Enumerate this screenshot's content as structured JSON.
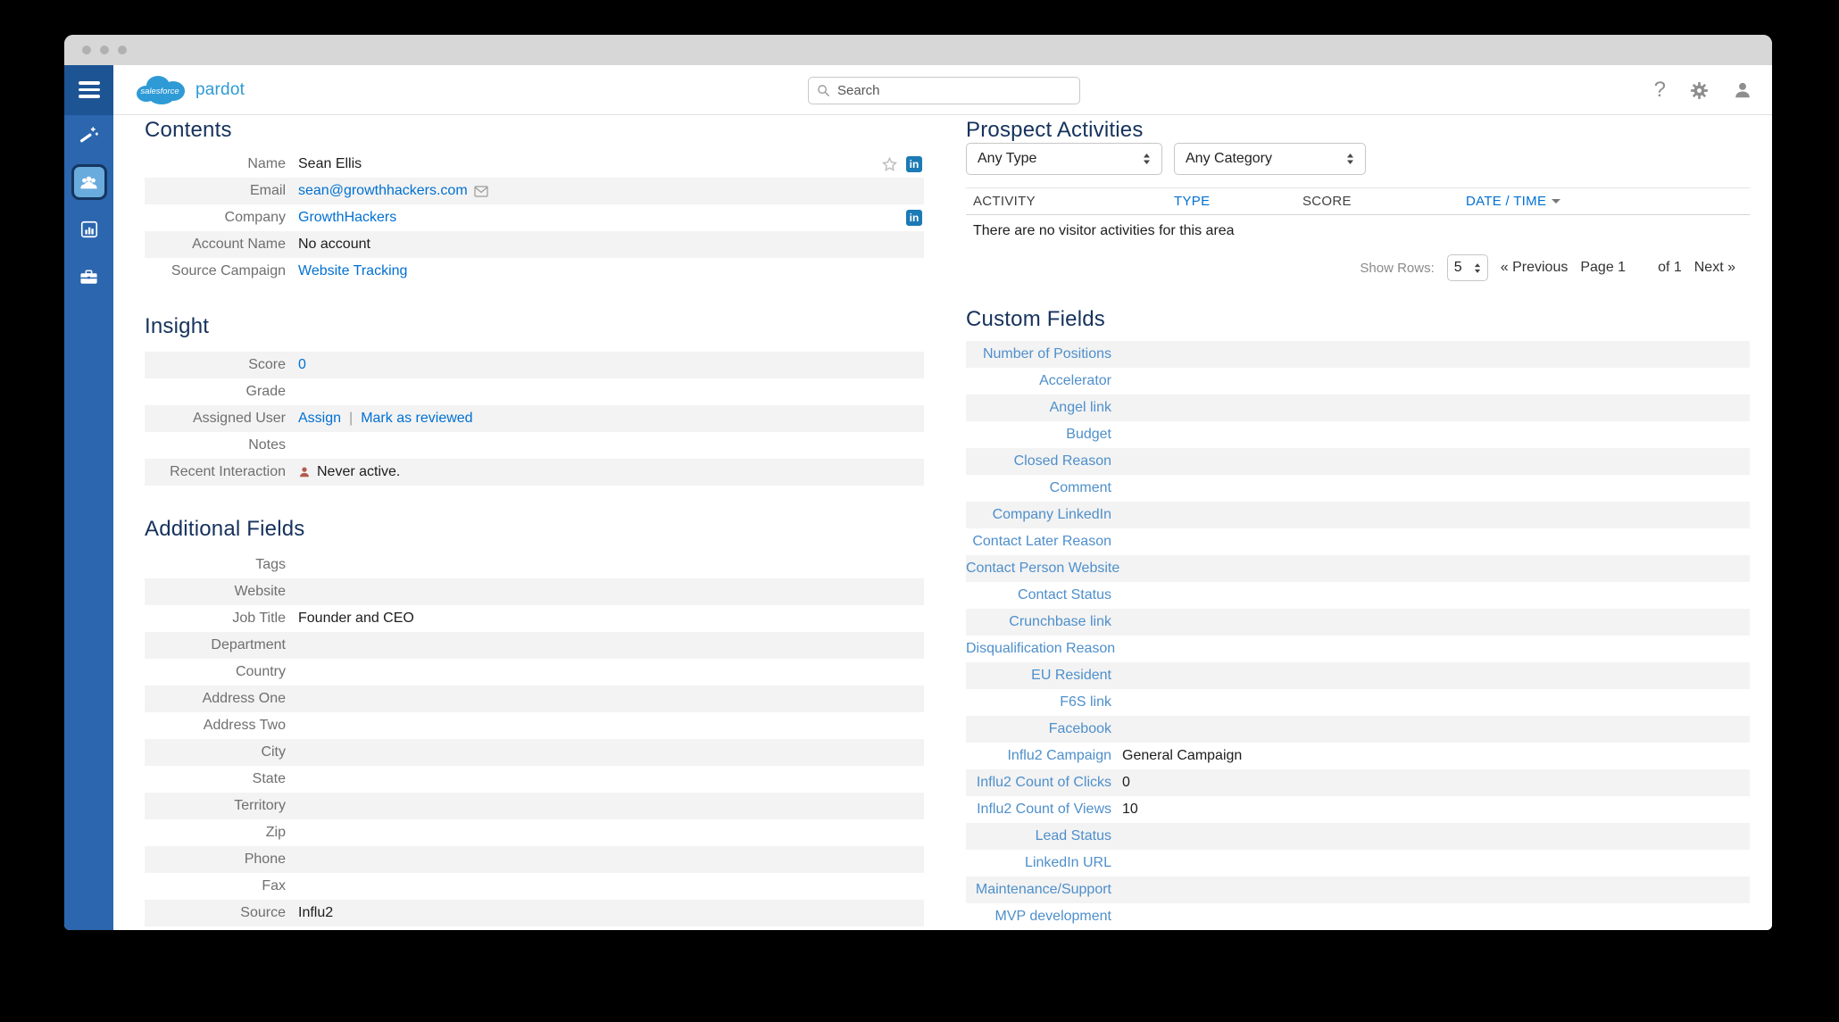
{
  "colors": {
    "link_blue": "#0070d2",
    "custom_link_blue": "#4e8fcb",
    "heading_navy": "#16325c",
    "sidebar_blue": "#2b66ae",
    "sidebar_dark_blue": "#1d5494",
    "row_stripe": "#f3f3f3",
    "linkedin_blue": "#1c7ab5",
    "inactive_red": "#b25b4f",
    "logo_blue": "#2e9ad6"
  },
  "topbar": {
    "logo": {
      "salesforce": "salesforce",
      "product": "pardot"
    },
    "search": {
      "placeholder": "Search"
    },
    "icons": [
      "help-icon",
      "gear-icon",
      "user-icon"
    ]
  },
  "sidebar": {
    "items": [
      {
        "icon": "wand-icon",
        "active": false
      },
      {
        "icon": "prospects-users-icon",
        "active": true
      },
      {
        "icon": "bar-chart-icon",
        "active": false
      },
      {
        "icon": "briefcase-icon",
        "active": false
      }
    ]
  },
  "contents": {
    "title": "Contents",
    "rows": [
      {
        "label": "Name",
        "value": "Sean Ellis",
        "trailing": [
          "star-icon",
          "linkedin-icon"
        ]
      },
      {
        "label": "Email",
        "value": "sean@growthhackers.com",
        "link": true,
        "suffix_icon": "envelope-icon"
      },
      {
        "label": "Company",
        "value": "GrowthHackers",
        "link": true,
        "trailing": [
          "linkedin-icon"
        ]
      },
      {
        "label": "Account Name",
        "value": "No account"
      },
      {
        "label": "Source Campaign",
        "value": "Website Tracking",
        "link": true
      }
    ]
  },
  "insight": {
    "title": "Insight",
    "rows": [
      {
        "label": "Score",
        "value": "0",
        "link": true
      },
      {
        "label": "Grade",
        "value": ""
      },
      {
        "label": "Assigned User",
        "links": [
          "Assign",
          "Mark as reviewed"
        ]
      },
      {
        "label": "Notes",
        "value": ""
      },
      {
        "label": "Recent Interaction",
        "value": "Never active.",
        "prefix_icon": "person-icon"
      }
    ]
  },
  "additional_fields": {
    "title": "Additional Fields",
    "rows": [
      {
        "label": "Tags",
        "value": ""
      },
      {
        "label": "Website",
        "value": ""
      },
      {
        "label": "Job Title",
        "value": "Founder and CEO"
      },
      {
        "label": "Department",
        "value": ""
      },
      {
        "label": "Country",
        "value": ""
      },
      {
        "label": "Address One",
        "value": ""
      },
      {
        "label": "Address Two",
        "value": ""
      },
      {
        "label": "City",
        "value": ""
      },
      {
        "label": "State",
        "value": ""
      },
      {
        "label": "Territory",
        "value": ""
      },
      {
        "label": "Zip",
        "value": ""
      },
      {
        "label": "Phone",
        "value": ""
      },
      {
        "label": "Fax",
        "value": ""
      },
      {
        "label": "Source",
        "value": "Influ2"
      }
    ]
  },
  "prospect_activities": {
    "title": "Prospect Activities",
    "filters": [
      {
        "value": "Any Type"
      },
      {
        "value": "Any Category"
      }
    ],
    "table": {
      "headers": [
        {
          "label": "ACTIVITY",
          "link": false,
          "sort": false
        },
        {
          "label": "TYPE",
          "link": true,
          "sort": false
        },
        {
          "label": "SCORE",
          "link": false,
          "sort": false
        },
        {
          "label": "DATE / TIME",
          "link": true,
          "sort": true
        }
      ]
    },
    "empty_message": "There are no visitor activities for this area",
    "pagination": {
      "show_rows_label": "Show Rows:",
      "show_rows_value": "5",
      "previous": "« Previous",
      "page": "Page 1",
      "of": "of 1",
      "next": "Next »"
    }
  },
  "custom_fields": {
    "title": "Custom Fields",
    "rows": [
      {
        "label": "Number of Positions",
        "value": ""
      },
      {
        "label": "Accelerator",
        "value": ""
      },
      {
        "label": "Angel link",
        "value": ""
      },
      {
        "label": "Budget",
        "value": ""
      },
      {
        "label": "Closed Reason",
        "value": ""
      },
      {
        "label": "Comment",
        "value": ""
      },
      {
        "label": "Company LinkedIn",
        "value": ""
      },
      {
        "label": "Contact Later Reason",
        "value": ""
      },
      {
        "label": "Contact Person Website",
        "value": ""
      },
      {
        "label": "Contact Status",
        "value": ""
      },
      {
        "label": "Crunchbase link",
        "value": ""
      },
      {
        "label": "Disqualification Reason",
        "value": ""
      },
      {
        "label": "EU Resident",
        "value": ""
      },
      {
        "label": "F6S link",
        "value": ""
      },
      {
        "label": "Facebook",
        "value": ""
      },
      {
        "label": "Influ2 Campaign",
        "value": "General Campaign"
      },
      {
        "label": "Influ2 Count of Clicks",
        "value": "0"
      },
      {
        "label": "Influ2 Count of Views",
        "value": "10"
      },
      {
        "label": "Lead Status",
        "value": ""
      },
      {
        "label": "LinkedIn URL",
        "value": ""
      },
      {
        "label": "Maintenance/Support",
        "value": ""
      },
      {
        "label": "MVP development",
        "value": ""
      }
    ]
  }
}
